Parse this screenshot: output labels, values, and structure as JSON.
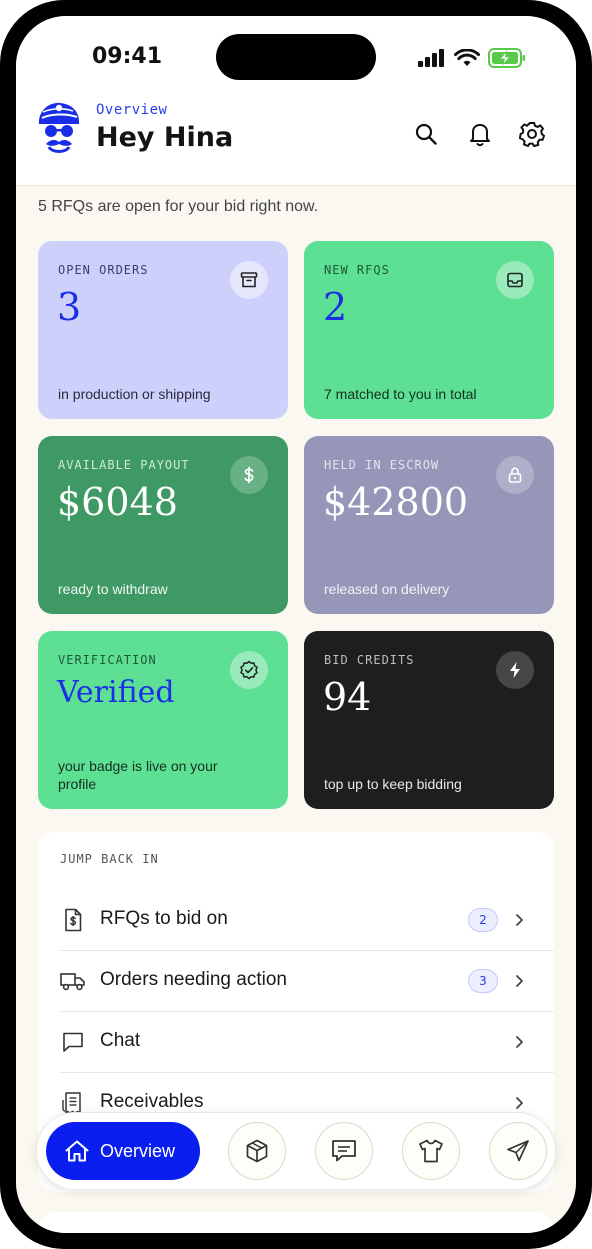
{
  "status_bar": {
    "time": "09:41"
  },
  "header": {
    "overline": "Overview",
    "greeting": "Hey Hina"
  },
  "intro": "5 RFQs are open for your bid right now.",
  "cards": [
    {
      "label": "OPEN ORDERS",
      "value": "3",
      "sub": "in production or shipping",
      "icon": "archive-icon"
    },
    {
      "label": "NEW RFQS",
      "value": "2",
      "sub": "7 matched to you in total",
      "icon": "inbox-icon"
    },
    {
      "label": "AVAILABLE PAYOUT",
      "value": "$6048",
      "sub": "ready to withdraw",
      "icon": "dollar-icon"
    },
    {
      "label": "HELD IN ESCROW",
      "value": "$42800",
      "sub": "released on delivery",
      "icon": "lock-icon"
    },
    {
      "label": "VERIFICATION",
      "value": "Verified",
      "sub": "your badge is live on your profile",
      "icon": "verified-badge-icon"
    },
    {
      "label": "BID CREDITS",
      "value": "94",
      "sub": "top up to keep bidding",
      "icon": "lightning-icon"
    }
  ],
  "jump_back": {
    "title": "JUMP BACK IN",
    "items": [
      {
        "label": "RFQs to bid on",
        "count": "2",
        "icon": "invoice-dollar-icon"
      },
      {
        "label": "Orders needing action",
        "count": "3",
        "icon": "truck-icon"
      },
      {
        "label": "Chat",
        "count": "",
        "icon": "chat-icon"
      },
      {
        "label": "Receivables",
        "count": "",
        "icon": "receipt-icon"
      }
    ]
  },
  "bottom_nav": {
    "active_label": "Overview",
    "items": [
      "home-icon",
      "package-icon",
      "message-icon",
      "tshirt-icon",
      "send-icon"
    ]
  },
  "colors": {
    "accent": "#0a1fef",
    "lavender": "#cdd0fb",
    "mint": "#5ddf94",
    "forest": "#3f9964",
    "slate_purple": "#9596b8",
    "charcoal": "#1e1e1e"
  }
}
